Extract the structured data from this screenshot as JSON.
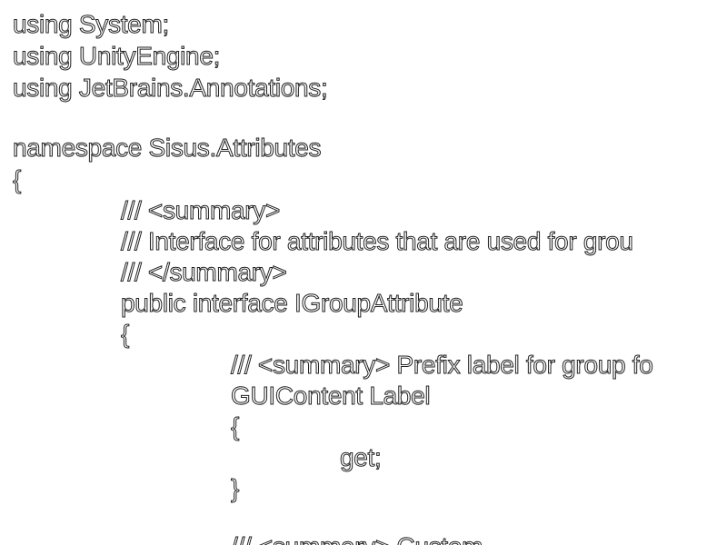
{
  "document": {
    "lines": [
      "using System;",
      "using UnityEngine;",
      "using JetBrains.Annotations;",
      "namespace Sisus.Attributes",
      "{",
      "/// <summary>",
      "/// Interface for attributes that are used for grou",
      "/// </summary>",
      "public interface IGroupAttribute",
      "{",
      "/// <summary> Prefix label for group fo",
      "GUIContent Label",
      "{",
      "get;",
      "}",
      "/// <summary> Custom"
    ]
  }
}
